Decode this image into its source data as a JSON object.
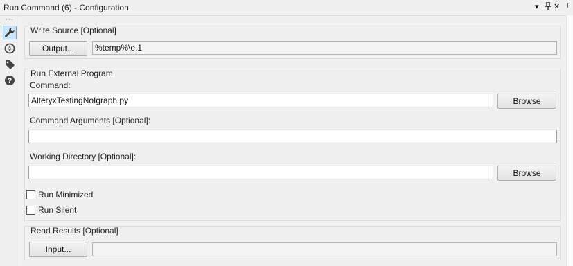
{
  "window": {
    "title": "Run Command (6) - Configuration",
    "controls": {
      "dropdown": "▾",
      "pin": "⊥",
      "close": "✕"
    }
  },
  "sidebar": {
    "icons": [
      "wrench-icon",
      "compass-icon",
      "tag-icon",
      "help-icon"
    ]
  },
  "write_source": {
    "title": "Write Source [Optional]",
    "button_label": "Output...",
    "value": "%temp%\\e.1"
  },
  "external_program": {
    "title": "Run External Program",
    "command_label": "Command:",
    "command_value": "AlteryxTestingNoIgraph.py",
    "browse_label": "Browse",
    "args_label": "Command Arguments [Optional]:",
    "args_value": "",
    "workdir_label": "Working Directory [Optional]:",
    "workdir_value": "",
    "workdir_browse_label": "Browse",
    "run_minimized_label": "Run Minimized",
    "run_minimized_checked": false,
    "run_silent_label": "Run Silent",
    "run_silent_checked": false
  },
  "read_results": {
    "title": "Read Results [Optional]",
    "button_label": "Input...",
    "value": ""
  },
  "colors": {
    "background": "#f0f0f0",
    "border": "#dcdcdc",
    "active_tool": "#cde3f7"
  }
}
